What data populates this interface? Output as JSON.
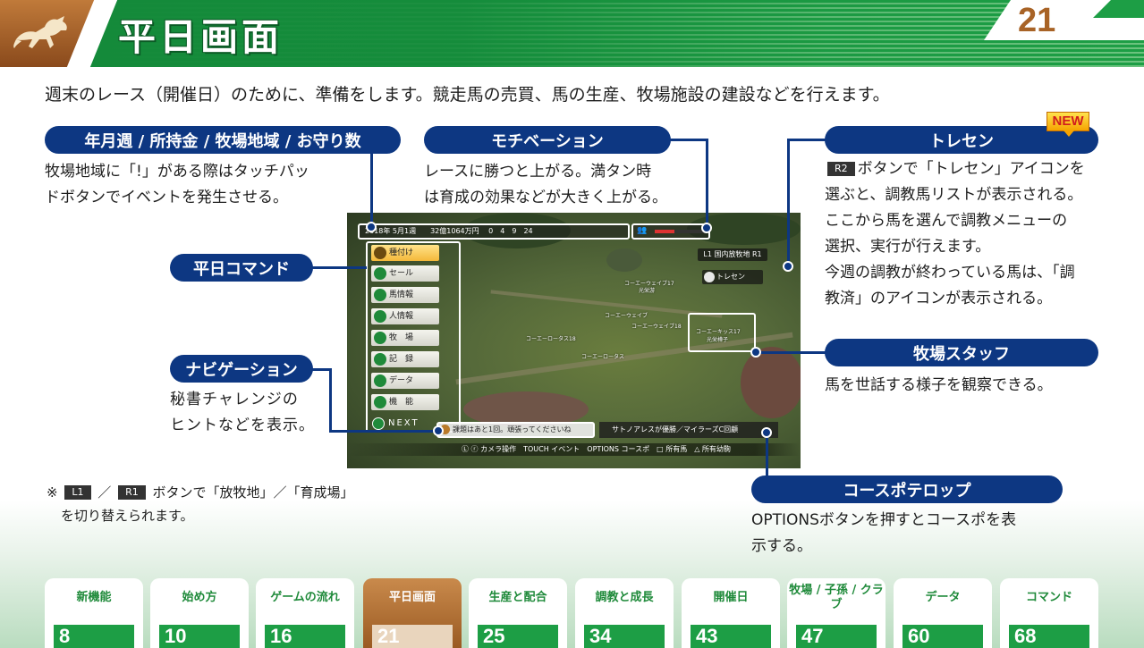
{
  "header": {
    "title": "平日画面",
    "page_number": "21"
  },
  "intro": "週末のレース（開催日）のために、準備をします。競走馬の売買、馬の生産、牧場施設の建設などを行えます。",
  "callouts": {
    "date": {
      "label": "年月週 / 所持金 / 牧場地域 / お守り数",
      "lines": [
        "牧場地域に「!」がある際はタッチパッ",
        "ドボタンでイベントを発生させる。"
      ]
    },
    "motivation": {
      "label": "モチベーション",
      "lines": [
        "レースに勝つと上がる。満タン時",
        "は育成の効果などが大きく上がる。"
      ]
    },
    "tresen": {
      "label": "トレセン",
      "new_badge": "NEW",
      "button": "R2",
      "lines": [
        "ボタンで「トレセン」アイコンを",
        "選ぶと、調教馬リストが表示される。",
        "ここから馬を選んで調教メニューの",
        "選択、実行が行えます。",
        "今週の調教が終わっている馬は、「調",
        "教済」のアイコンが表示される。"
      ]
    },
    "weekday_command": {
      "label": "平日コマンド"
    },
    "navigation": {
      "label": "ナビゲーション",
      "lines": [
        "秘書チャレンジの",
        "ヒントなどを表示。"
      ]
    },
    "staff": {
      "label": "牧場スタッフ",
      "lines": [
        "馬を世話する様子を観察できる。"
      ]
    },
    "course_telop": {
      "label": "コースポテロップ",
      "lines": [
        "OPTIONSボタンを押すとコースポを表",
        "示する。"
      ]
    }
  },
  "note": {
    "mark": "※",
    "l1": "L1",
    "slash": "／",
    "r1": "R1",
    "text1": "ボタンで「放牧地」／「育成場」",
    "text2": "を切り替えられます。"
  },
  "game": {
    "status": "2018年 5月1週　　32億1064万円",
    "items": "0　4　9　24",
    "motivation_level": 0.4,
    "commands": [
      "種付け",
      "セール",
      "馬情報",
      "人情報",
      "牧　場",
      "記　録",
      "データ",
      "機　能"
    ],
    "next": "NEXT",
    "farm_tag": "L1 国内放牧地 R1",
    "tresen_tag": "トレセン",
    "horse_labels": [
      "コーエーウェイブ17",
      "光栄游",
      "コーエーウェイブ",
      "コーエーウェイブ18",
      "コーエーロータス18",
      "コーエーロータス",
      "コーエーキッス17",
      "光栄樺子"
    ],
    "nav_message": "課題はあと1回。頑張ってくださいね",
    "telop": "サトノアレスが優勝／マイラーズC回顧",
    "controls": "Ⓛ ⓡ カメラ操作　TOUCH イベント　OPTIONS コースポ　□ 所有馬　△ 所有幼駒"
  },
  "tabs": [
    {
      "label": "新機能",
      "page": "8"
    },
    {
      "label": "始め方",
      "page": "10"
    },
    {
      "label": "ゲームの流れ",
      "page": "16"
    },
    {
      "label": "平日画面",
      "page": "21",
      "active": true
    },
    {
      "label": "生産と配合",
      "page": "25"
    },
    {
      "label": "調教と成長",
      "page": "34"
    },
    {
      "label": "開催日",
      "page": "43"
    },
    {
      "label": "牧場 / 子孫 / クラブ",
      "page": "47"
    },
    {
      "label": "データ",
      "page": "60"
    },
    {
      "label": "コマンド",
      "page": "68"
    }
  ],
  "colors": {
    "navy": "#0d3782",
    "green": "#1d9e45",
    "brown": "#a86326"
  }
}
